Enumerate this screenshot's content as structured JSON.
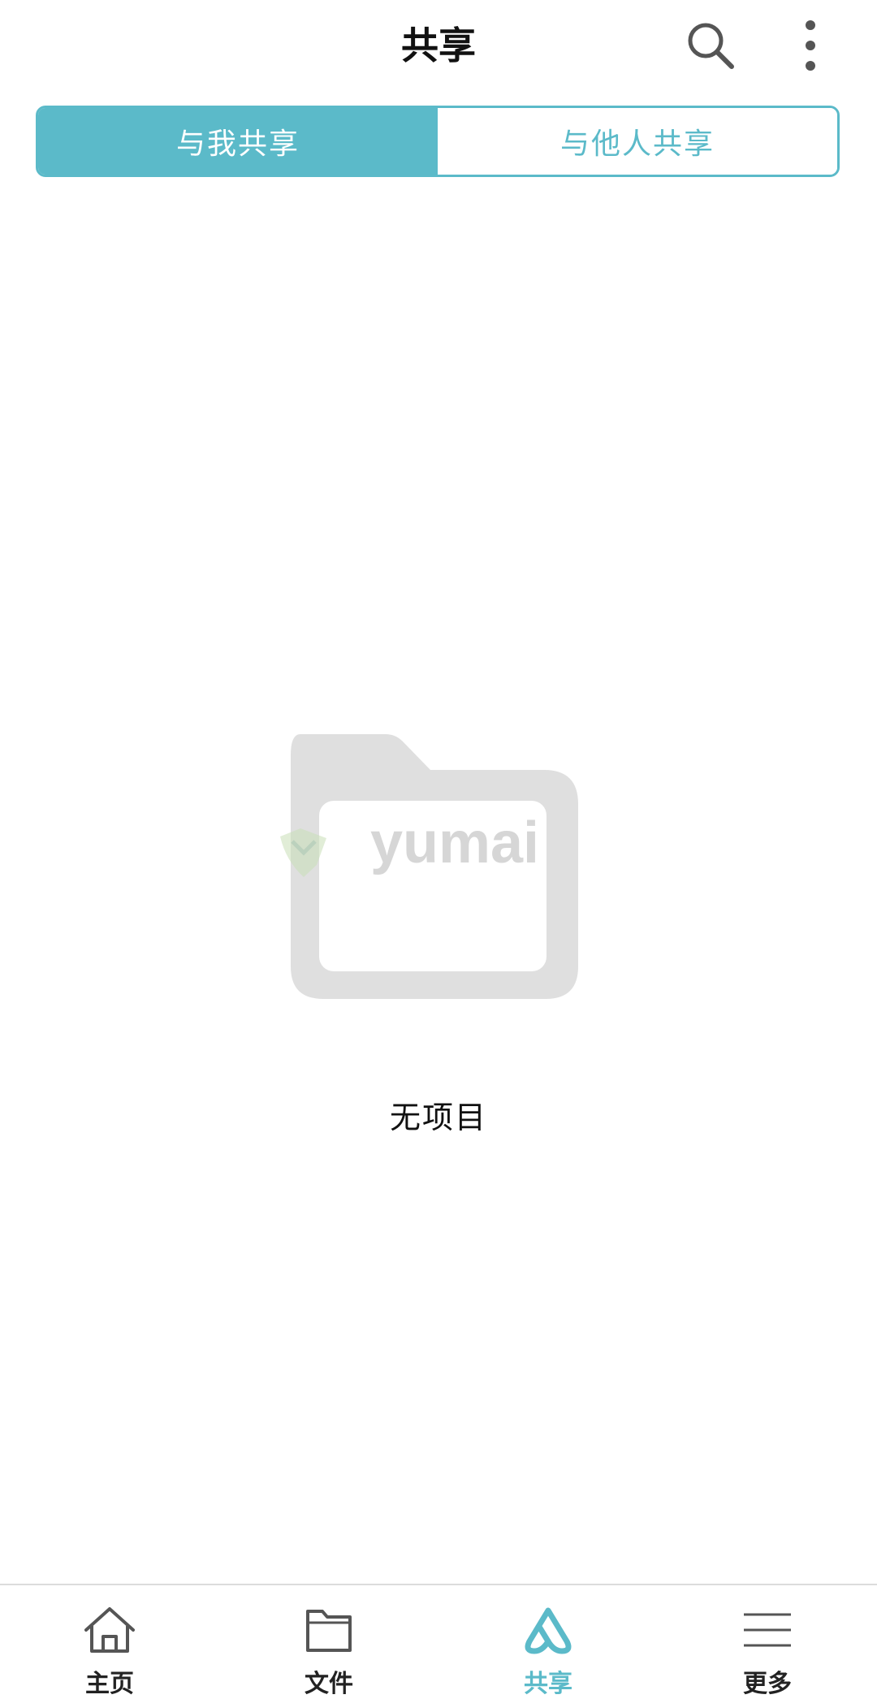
{
  "header": {
    "title": "共享",
    "search_icon": "search-icon",
    "more_icon": "more-vertical-icon"
  },
  "tabs": [
    {
      "label": "与我共享",
      "active": true
    },
    {
      "label": "与他人共享",
      "active": false
    }
  ],
  "empty_state": {
    "icon": "folder-icon",
    "watermark": "yumai",
    "message": "无项目"
  },
  "bottom_nav": [
    {
      "label": "主页",
      "icon": "home-icon",
      "active": false
    },
    {
      "label": "文件",
      "icon": "folder-icon",
      "active": false
    },
    {
      "label": "共享",
      "icon": "share-icon",
      "active": true
    },
    {
      "label": "更多",
      "icon": "menu-icon",
      "active": false
    }
  ],
  "colors": {
    "accent": "#5bbac9",
    "empty_folder": "#dfdfdf",
    "text": "#111111"
  }
}
